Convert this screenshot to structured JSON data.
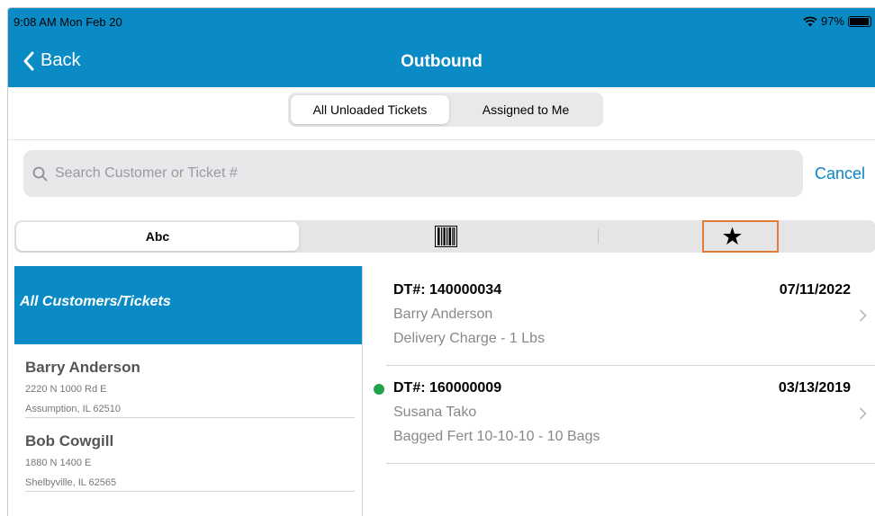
{
  "status": {
    "time": "9:08 AM   Mon Feb 20",
    "battery": "97%"
  },
  "nav": {
    "back_label": "Back",
    "title": "Outbound"
  },
  "tabs": {
    "all": "All Unloaded Tickets",
    "assigned": "Assigned to Me"
  },
  "search": {
    "placeholder": "Search Customer or Ticket #",
    "value": "",
    "cancel": "Cancel"
  },
  "sort": {
    "alpha": "Abc",
    "barcode_icon": "barcode-icon",
    "star_icon": "star-icon"
  },
  "sidebar": {
    "all_label": "All Customers/Tickets",
    "customers": [
      {
        "name": "Barry Anderson",
        "address": "2220 N 1000 Rd E",
        "city": "Assumption, IL 62510"
      },
      {
        "name": "Bob Cowgill",
        "address": "1880 N 1400 E",
        "city": "Shelbyville, IL 62565"
      }
    ]
  },
  "tickets": [
    {
      "dt": "DT#: 140000034",
      "date": "07/11/2022",
      "customer": "Barry Anderson",
      "desc": "Delivery Charge - 1  Lbs",
      "dot": false
    },
    {
      "dt": "DT#: 160000009",
      "date": "03/13/2019",
      "customer": "Susana Tako",
      "desc": "Bagged Fert 10-10-10 - 10  Bags",
      "dot": true
    }
  ],
  "colors": {
    "header": "#0b8bc6",
    "accent": "#0a84c8",
    "highlight_frame": "#e07b39",
    "dot": "#22a24a"
  }
}
